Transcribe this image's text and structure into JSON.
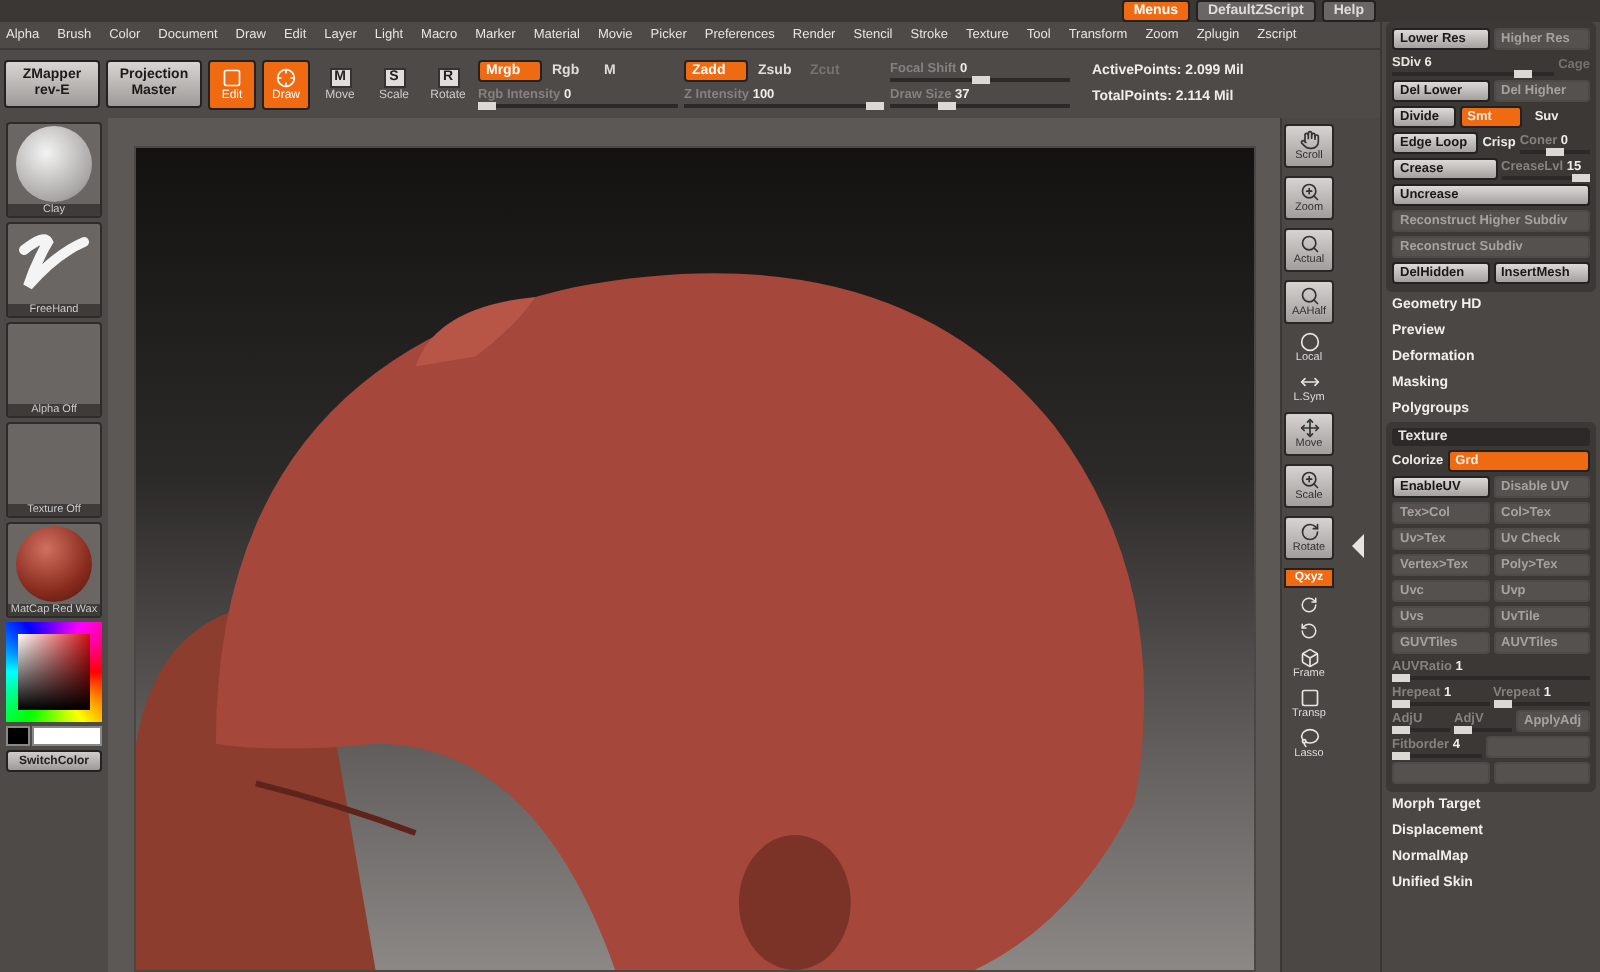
{
  "title_bar": {
    "buttons": [
      {
        "label": "Menus",
        "selected": true
      },
      {
        "label": "DefaultZScript",
        "selected": false
      },
      {
        "label": "Help",
        "selected": false
      }
    ]
  },
  "menu_bar": [
    "Alpha",
    "Brush",
    "Color",
    "Document",
    "Draw",
    "Edit",
    "Layer",
    "Light",
    "Macro",
    "Marker",
    "Material",
    "Movie",
    "Picker",
    "Preferences",
    "Render",
    "Stencil",
    "Stroke",
    "Texture",
    "Tool",
    "Transform",
    "Zoom",
    "Zplugin",
    "Zscript"
  ],
  "toolbar": {
    "plugins": [
      {
        "label": "ZMapper",
        "sub": "rev-E"
      },
      {
        "label": "Projection",
        "sub": "Master"
      }
    ],
    "modes": [
      {
        "label": "Edit",
        "selected": true
      },
      {
        "label": "Draw",
        "selected": true
      }
    ],
    "transforms": [
      {
        "label": "Move",
        "letter": "M"
      },
      {
        "label": "Scale",
        "letter": "S"
      },
      {
        "label": "Rotate",
        "letter": "R"
      }
    ],
    "color_modes": [
      {
        "label": "Mrgb",
        "selected": true,
        "disabled": false
      },
      {
        "label": "Rgb",
        "selected": false,
        "disabled": false
      },
      {
        "label": "M",
        "selected": false,
        "disabled": false
      }
    ],
    "z_modes": [
      {
        "label": "Zadd",
        "selected": true,
        "disabled": false
      },
      {
        "label": "Zsub",
        "selected": false,
        "disabled": false
      },
      {
        "label": "Zcut",
        "selected": false,
        "disabled": true
      }
    ],
    "sliders": [
      {
        "label": "Rgb Intensity",
        "value": "0",
        "level": 0,
        "disabled": true
      },
      {
        "label": "Z Intensity",
        "value": "100",
        "level": 1,
        "disabled": true
      },
      {
        "label": "Focal Shift",
        "value": "0",
        "level": 0.5,
        "disabled": true
      },
      {
        "label": "Draw Size",
        "value": "37",
        "level": 0.3,
        "disabled": true
      }
    ],
    "stats": [
      "ActivePoints: 2.099 Mil",
      "TotalPoints: 2.114 Mil"
    ]
  },
  "shelf": [
    {
      "label": "Clay",
      "kind": "brush"
    },
    {
      "label": "FreeHand",
      "kind": "stroke"
    },
    {
      "label": "Alpha Off",
      "kind": "empty"
    },
    {
      "label": "Texture Off",
      "kind": "empty"
    },
    {
      "label": "MatCap Red Wax",
      "kind": "material"
    }
  ],
  "color_picker": {
    "swatches": [
      {
        "color": "#000000"
      },
      {
        "color": "#ffffff"
      }
    ],
    "button": "SwitchColor"
  },
  "view_tools": [
    {
      "kind": "tile",
      "label": "Scroll"
    },
    {
      "kind": "tile",
      "label": "Zoom"
    },
    {
      "kind": "tile",
      "label": "Actual"
    },
    {
      "kind": "tile",
      "label": "AAHalf"
    },
    {
      "kind": "plain",
      "label": "Local"
    },
    {
      "kind": "plain",
      "label": "L.Sym"
    },
    {
      "kind": "tile",
      "label": "Move"
    },
    {
      "kind": "tile",
      "label": "Scale"
    },
    {
      "kind": "tile",
      "label": "Rotate"
    },
    {
      "kind": "toggle",
      "label": "Qxyz",
      "selected": true
    },
    {
      "kind": "icon"
    },
    {
      "kind": "icon"
    },
    {
      "kind": "plain",
      "label": "Frame"
    },
    {
      "kind": "plain",
      "label": "Transp"
    },
    {
      "kind": "plain",
      "label": "Lasso"
    }
  ],
  "geometry": [
    {
      "cells": [
        {
          "kind": "button",
          "label": "Lower Res",
          "disabled": false
        },
        {
          "kind": "button",
          "label": "Higher Res",
          "disabled": true
        }
      ]
    },
    {
      "cells": [
        {
          "kind": "slider",
          "label": "SDiv",
          "value": "6",
          "level": 0.85,
          "disabled": false
        },
        {
          "kind": "label",
          "label": "Cage",
          "disabled": true
        }
      ]
    },
    {
      "cells": [
        {
          "kind": "button",
          "label": "Del Lower",
          "disabled": false
        },
        {
          "kind": "button",
          "label": "Del Higher",
          "disabled": true
        }
      ]
    },
    {
      "cells": [
        {
          "kind": "button",
          "label": "Divide",
          "disabled": false
        },
        {
          "kind": "toggle",
          "label": "Smt",
          "selected": true
        },
        {
          "kind": "toggle",
          "label": "Suv",
          "selected": false
        }
      ]
    },
    {
      "cells": [
        {
          "kind": "button",
          "label": "Edge Loop",
          "disabled": false
        },
        {
          "kind": "label",
          "label": "Crisp",
          "disabled": false
        },
        {
          "kind": "slider",
          "label": "Coner",
          "value": "0",
          "level": 0.5,
          "disabled": true
        }
      ]
    },
    {
      "cells": [
        {
          "kind": "button",
          "label": "Crease",
          "disabled": false
        },
        {
          "kind": "slider",
          "label": "CreaseLvl",
          "value": "15",
          "level": 1,
          "disabled": true
        }
      ]
    },
    {
      "cells": [
        {
          "kind": "button",
          "label": "Uncrease",
          "disabled": false
        }
      ]
    },
    {
      "cells": [
        {
          "kind": "button",
          "label": "Reconstruct Higher Subdiv",
          "disabled": true
        }
      ]
    },
    {
      "cells": [
        {
          "kind": "button",
          "label": "Reconstruct Subdiv",
          "disabled": true
        }
      ]
    },
    {
      "cells": [
        {
          "kind": "button",
          "label": "DelHidden",
          "disabled": false
        },
        {
          "kind": "button",
          "label": "InsertMesh",
          "disabled": false
        }
      ]
    }
  ],
  "sections_before": [
    "Geometry HD",
    "Preview",
    "Deformation",
    "Masking",
    "Polygroups"
  ],
  "texture": {
    "title": "Texture",
    "rows": [
      {
        "cells": [
          {
            "kind": "label",
            "label": "Colorize",
            "disabled": false
          },
          {
            "kind": "toggle",
            "label": "Grd",
            "selected": true
          }
        ]
      },
      {
        "cells": [
          {
            "kind": "button",
            "label": "EnableUV",
            "disabled": false
          },
          {
            "kind": "button",
            "label": "Disable UV",
            "disabled": true
          }
        ]
      },
      {
        "cells": [
          {
            "kind": "button",
            "label": "Tex>Col",
            "disabled": true
          },
          {
            "kind": "button",
            "label": "Col>Tex",
            "disabled": true
          }
        ]
      },
      {
        "cells": [
          {
            "kind": "button",
            "label": "Uv>Tex",
            "disabled": true
          },
          {
            "kind": "button",
            "label": "Uv Check",
            "disabled": true
          }
        ]
      },
      {
        "cells": [
          {
            "kind": "button",
            "label": "Vertex>Tex",
            "disabled": true
          },
          {
            "kind": "button",
            "label": "Poly>Tex",
            "disabled": true
          }
        ]
      },
      {
        "cells": [
          {
            "kind": "button",
            "label": "Uvc",
            "disabled": true
          },
          {
            "kind": "button",
            "label": "Uvp",
            "disabled": true
          }
        ]
      },
      {
        "cells": [
          {
            "kind": "button",
            "label": "Uvs",
            "disabled": true
          },
          {
            "kind": "button",
            "label": "UvTile",
            "disabled": true
          }
        ]
      },
      {
        "cells": [
          {
            "kind": "button",
            "label": "GUVTiles",
            "disabled": true
          },
          {
            "kind": "button",
            "label": "AUVTiles",
            "disabled": true
          }
        ]
      },
      {
        "cells": [
          {
            "kind": "slider",
            "label": "AUVRatio",
            "value": "1",
            "level": 0,
            "disabled": true
          }
        ]
      },
      {
        "cells": [
          {
            "kind": "slider",
            "label": "Hrepeat",
            "value": "1",
            "level": 0,
            "disabled": true
          },
          {
            "kind": "slider",
            "label": "Vrepeat",
            "value": "1",
            "level": 0,
            "disabled": true
          }
        ]
      },
      {
        "cells": [
          {
            "kind": "slider",
            "label": "AdjU",
            "level": 0,
            "disabled": true
          },
          {
            "kind": "slider",
            "label": "AdjV",
            "level": 0,
            "disabled": true
          },
          {
            "kind": "button",
            "label": "ApplyAdj",
            "disabled": true
          }
        ]
      },
      {
        "cells": [
          {
            "kind": "slider",
            "label": "Fitborder",
            "value": "4",
            "level": 0,
            "disabled": true
          },
          {
            "kind": "button",
            "disabled": true
          }
        ]
      },
      {
        "cells": [
          {
            "kind": "button",
            "disabled": true
          },
          {
            "kind": "button",
            "disabled": true
          }
        ]
      }
    ]
  },
  "sections_after": [
    "Morph Target",
    "Displacement",
    "NormalMap",
    "Unified Skin"
  ]
}
